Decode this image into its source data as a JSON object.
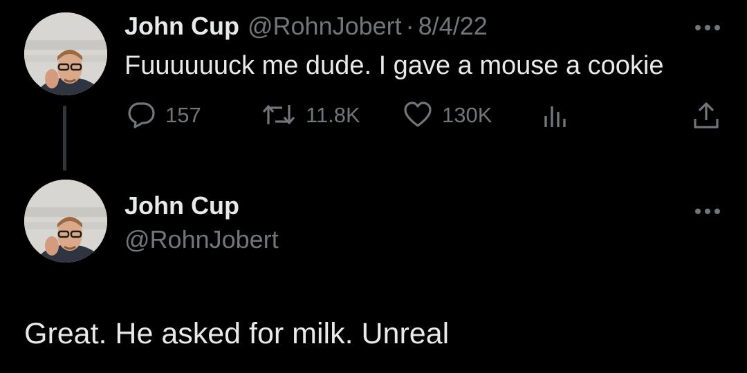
{
  "tweet1": {
    "author_name": "John Cup",
    "handle": "@RohnJobert",
    "separator": "·",
    "date": "8/4/22",
    "text": "Fuuuuuuck me dude. I gave a mouse a cookie",
    "more_icon": "ellipsis-icon",
    "actions": {
      "reply": {
        "icon": "reply-icon",
        "count": "157"
      },
      "retweet": {
        "icon": "retweet-icon",
        "count": "11.8K"
      },
      "like": {
        "icon": "heart-icon",
        "count": "130K"
      },
      "views": {
        "icon": "views-chart-icon"
      },
      "share": {
        "icon": "share-icon"
      }
    }
  },
  "tweet2": {
    "author_name": "John Cup",
    "handle": "@RohnJobert",
    "text": "Great. He asked for milk. Unreal",
    "more_icon": "ellipsis-icon"
  },
  "colors": {
    "background": "#000000",
    "primary_text": "#e7e9ea",
    "secondary_text": "#71767b",
    "thread_line": "#333639"
  }
}
